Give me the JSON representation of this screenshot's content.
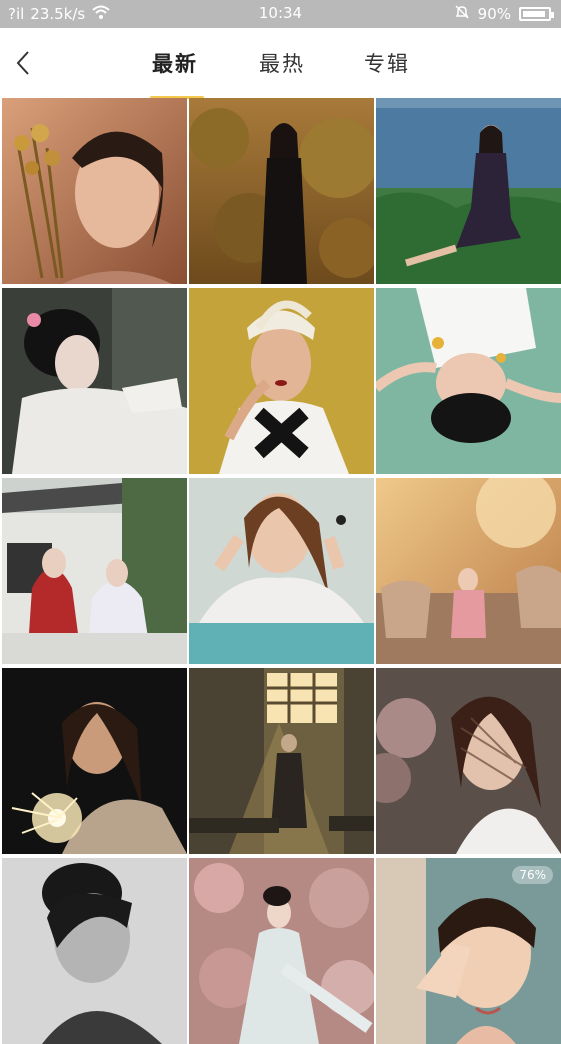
{
  "status_bar": {
    "signal": "?il",
    "speed": "23.5k/s",
    "time": "10:34",
    "battery_text": "90%",
    "battery_level": 0.9
  },
  "header": {
    "tabs": [
      {
        "label": "最新",
        "active": true
      },
      {
        "label": "最热",
        "active": false
      },
      {
        "label": "专辑",
        "active": false
      }
    ],
    "accent_color": "#f2c94c"
  },
  "grid": {
    "photos": [
      {
        "id": "warm portrait with dried flowers"
      },
      {
        "id": "woman in black in autumn trees"
      },
      {
        "id": "woman sitting by the sea"
      },
      {
        "id": "hanfu girl by window"
      },
      {
        "id": "woman with headscarf on yellow"
      },
      {
        "id": "girl lying on green floor"
      },
      {
        "id": "two girls in hanfu at pavilion"
      },
      {
        "id": "smiling woman in white sweater"
      },
      {
        "id": "girl reading on balcony"
      },
      {
        "id": "girl with sparkler at night"
      },
      {
        "id": "figure in sunlit window room"
      },
      {
        "id": "girl with lace shadow"
      },
      {
        "id": "black and white portrait"
      },
      {
        "id": "girl among plum blossoms"
      },
      {
        "id": "smiling girl covering eye",
        "badge": "76%"
      }
    ]
  }
}
